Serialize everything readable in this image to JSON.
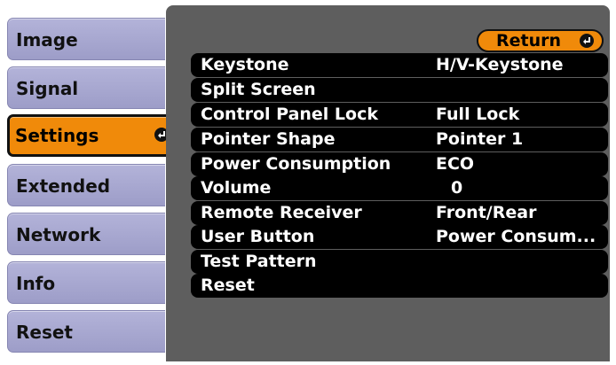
{
  "sidebar": {
    "items": [
      {
        "label": "Image"
      },
      {
        "label": "Signal"
      },
      {
        "label": "Settings"
      },
      {
        "label": "Extended"
      },
      {
        "label": "Network"
      },
      {
        "label": "Info"
      },
      {
        "label": "Reset"
      }
    ],
    "active": "Settings"
  },
  "panel": {
    "return_label": "Return",
    "rows": [
      {
        "label": "Keystone",
        "value": "H/V-Keystone"
      },
      {
        "label": "Split Screen",
        "value": ""
      },
      {
        "label": "Control Panel Lock",
        "value": "Full Lock"
      },
      {
        "label": "Pointer Shape",
        "value": "Pointer 1"
      },
      {
        "label": "Power Consumption",
        "value": "ECO"
      },
      {
        "label": "Volume",
        "value": "0"
      },
      {
        "label": "Remote Receiver",
        "value": "Front/Rear"
      },
      {
        "label": "User Button",
        "value": "Power Consum..."
      },
      {
        "label": "Test Pattern",
        "value": ""
      },
      {
        "label": "Reset",
        "value": ""
      }
    ]
  },
  "colors": {
    "accent": "#f08a0a",
    "tab": "#a9a9d4",
    "panel": "#5e5e5e",
    "row": "#000000"
  },
  "icons": {
    "enter": "enter-icon"
  }
}
